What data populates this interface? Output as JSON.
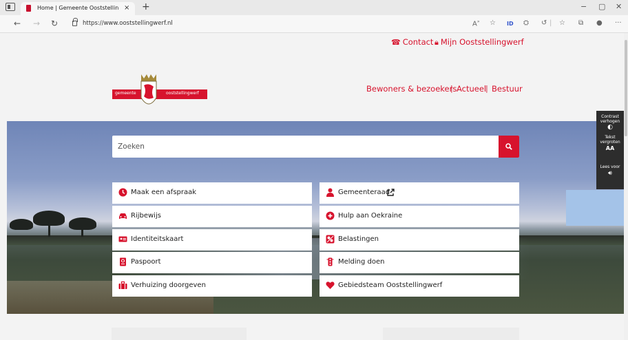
{
  "browser": {
    "tab_title": "Home | Gemeente Ooststellingwerf",
    "new_tab": "+",
    "tab_close": "×",
    "url": "https://www.ooststellingwerf.nl",
    "win_min": "−",
    "win_max": "▢",
    "win_close": "✕",
    "nav_back": "←",
    "nav_forward": "→",
    "nav_reload": "↻"
  },
  "topbar": {
    "contact": "Contact",
    "mijn": "Mijn Ooststellingwerf"
  },
  "logo": {
    "left": "gemeente",
    "right": "ooststellingwerf"
  },
  "nav": {
    "items": [
      "Bewoners & bezoekers",
      "Actueel",
      "Bestuur"
    ],
    "separator": "|"
  },
  "search": {
    "placeholder": "Zoeken"
  },
  "tiles_left": [
    {
      "label": "Maak een afspraak",
      "icon": "clock-icon"
    },
    {
      "label": "Rijbewijs",
      "icon": "car-icon"
    },
    {
      "label": "Identiteitskaart",
      "icon": "id-card-icon"
    },
    {
      "label": "Paspoort",
      "icon": "passport-icon"
    },
    {
      "label": "Verhuizing doorgeven",
      "icon": "suitcase-icon"
    }
  ],
  "tiles_right": [
    {
      "label": "Gemeenteraad",
      "icon": "person-icon"
    },
    {
      "label": "Hulp aan Oekraine",
      "icon": "plus-circle-icon"
    },
    {
      "label": "Belastingen",
      "icon": "coins-icon"
    },
    {
      "label": "Melding doen",
      "icon": "traffic-light-icon"
    },
    {
      "label": "Gebiedsteam Ooststellingwerf",
      "icon": "heart-icon"
    }
  ],
  "a11y": {
    "contrast_1": "Contrast",
    "contrast_2": "verhogen",
    "text_1": "Tekst",
    "text_2": "vergroten",
    "text_icon": "AA",
    "read_1": "Lees voor"
  },
  "colors": {
    "brand": "#d7132d",
    "a11y_panel": "#2d2d2d"
  }
}
